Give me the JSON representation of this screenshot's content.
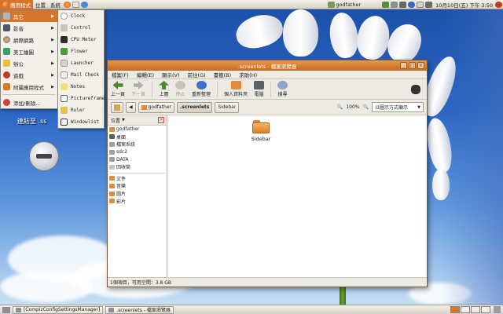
{
  "top_panel": {
    "menus": [
      "應用程式",
      "位置",
      "系統"
    ],
    "user": "godfather",
    "clock": "10月10日(五) 下午 3:50"
  },
  "apps_menu": {
    "items": [
      {
        "label": "其它",
        "submenu": true
      },
      {
        "label": "影音",
        "submenu": true
      },
      {
        "label": "網際網路",
        "submenu": true
      },
      {
        "label": "美工繪圖",
        "submenu": true
      },
      {
        "label": "辦公",
        "submenu": true
      },
      {
        "label": "遊戲",
        "submenu": true
      },
      {
        "label": "附屬應用程式",
        "submenu": true
      }
    ],
    "add_remove": "添加/刪除..."
  },
  "screenlets_menu": {
    "items": [
      "Clock",
      "Control",
      "CPU Meter",
      "Flower",
      "Launcher",
      "Mail Check",
      "Notes",
      "Pictureframe",
      "Ruler",
      "Windowlist"
    ]
  },
  "desktop": {
    "icon_label": "連結至 .ss"
  },
  "window": {
    "title": ".screenlets - 檔案瀏覽器",
    "menubar": [
      "檔案(F)",
      "編輯(E)",
      "顯示(V)",
      "前往(G)",
      "書籤(B)",
      "求助(H)"
    ],
    "toolbar": {
      "back": "上一頁",
      "forward": "下一頁",
      "up": "上層",
      "stop": "停止",
      "reload": "重新整理",
      "home": "個人資料夾",
      "computer": "電腦",
      "search": "搜尋"
    },
    "path": [
      "godfather",
      ".screenlets",
      "Sidebar"
    ],
    "zoom": "100%",
    "view_mode": "以圖示方式顯示",
    "sidebar_title": "位置",
    "places": [
      "godfather",
      "桌面",
      "檔案系統",
      "sdc2",
      "DATA",
      "回收筒"
    ],
    "bookmarks": [
      "文件",
      "音樂",
      "圖片",
      "影片"
    ],
    "files": [
      {
        "name": "Sidebar"
      }
    ],
    "status": "1個項目，可用空間：3.8 GB"
  },
  "taskbar": {
    "tasks": [
      "[CompizConfigSettingsManager]",
      ".screenlets - 檔案瀏覽器"
    ]
  }
}
